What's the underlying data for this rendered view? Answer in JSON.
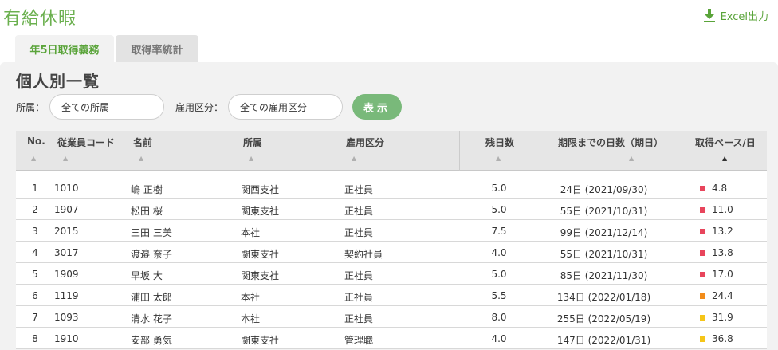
{
  "header": {
    "title": "有給休暇",
    "export_label": "Excel出力"
  },
  "tabs": [
    {
      "label": "年5日取得義務",
      "active": true
    },
    {
      "label": "取得率統計",
      "active": false
    }
  ],
  "panel": {
    "title": "個人別一覧"
  },
  "filters": {
    "dept_label": "所属：",
    "dept_value": "全ての所属",
    "emp_label": "雇用区分：",
    "emp_value": "全ての雇用区分",
    "show_label": "表示"
  },
  "table": {
    "columns": [
      "No.",
      "従業員コード",
      "名前",
      "所属",
      "雇用区分",
      "残日数",
      "期限までの日数（期日）",
      "取得ペース/日"
    ],
    "sort_glyph": "▲",
    "rows": [
      {
        "no": "1",
        "code": "1010",
        "name": "嶋 正樹",
        "dept": "関西支社",
        "emp": "正社員",
        "remaining": "5.0",
        "days": "24日 (2021/09/30)",
        "pace": "4.8",
        "color": "#e8455c"
      },
      {
        "no": "2",
        "code": "1907",
        "name": "松田 桜",
        "dept": "関東支社",
        "emp": "正社員",
        "remaining": "5.0",
        "days": "55日 (2021/10/31)",
        "pace": "11.0",
        "color": "#e8455c"
      },
      {
        "no": "3",
        "code": "2015",
        "name": "三田 三美",
        "dept": "本社",
        "emp": "正社員",
        "remaining": "7.5",
        "days": "99日 (2021/12/14)",
        "pace": "13.2",
        "color": "#e8455c"
      },
      {
        "no": "4",
        "code": "3017",
        "name": "渡邉 奈子",
        "dept": "関東支社",
        "emp": "契約社員",
        "remaining": "4.0",
        "days": "55日 (2021/10/31)",
        "pace": "13.8",
        "color": "#e8455c"
      },
      {
        "no": "5",
        "code": "1909",
        "name": "早坂 大",
        "dept": "関東支社",
        "emp": "正社員",
        "remaining": "5.0",
        "days": "85日 (2021/11/30)",
        "pace": "17.0",
        "color": "#e8455c"
      },
      {
        "no": "6",
        "code": "1119",
        "name": "浦田 太郎",
        "dept": "本社",
        "emp": "正社員",
        "remaining": "5.5",
        "days": "134日 (2022/01/18)",
        "pace": "24.4",
        "color": "#f28c1a"
      },
      {
        "no": "7",
        "code": "1093",
        "name": "清水 花子",
        "dept": "本社",
        "emp": "正社員",
        "remaining": "8.0",
        "days": "255日 (2022/05/19)",
        "pace": "31.9",
        "color": "#f5c518"
      },
      {
        "no": "8",
        "code": "1910",
        "name": "安部 勇気",
        "dept": "関東支社",
        "emp": "管理職",
        "remaining": "4.0",
        "days": "147日 (2022/01/31)",
        "pace": "36.8",
        "color": "#f5c518"
      }
    ]
  }
}
